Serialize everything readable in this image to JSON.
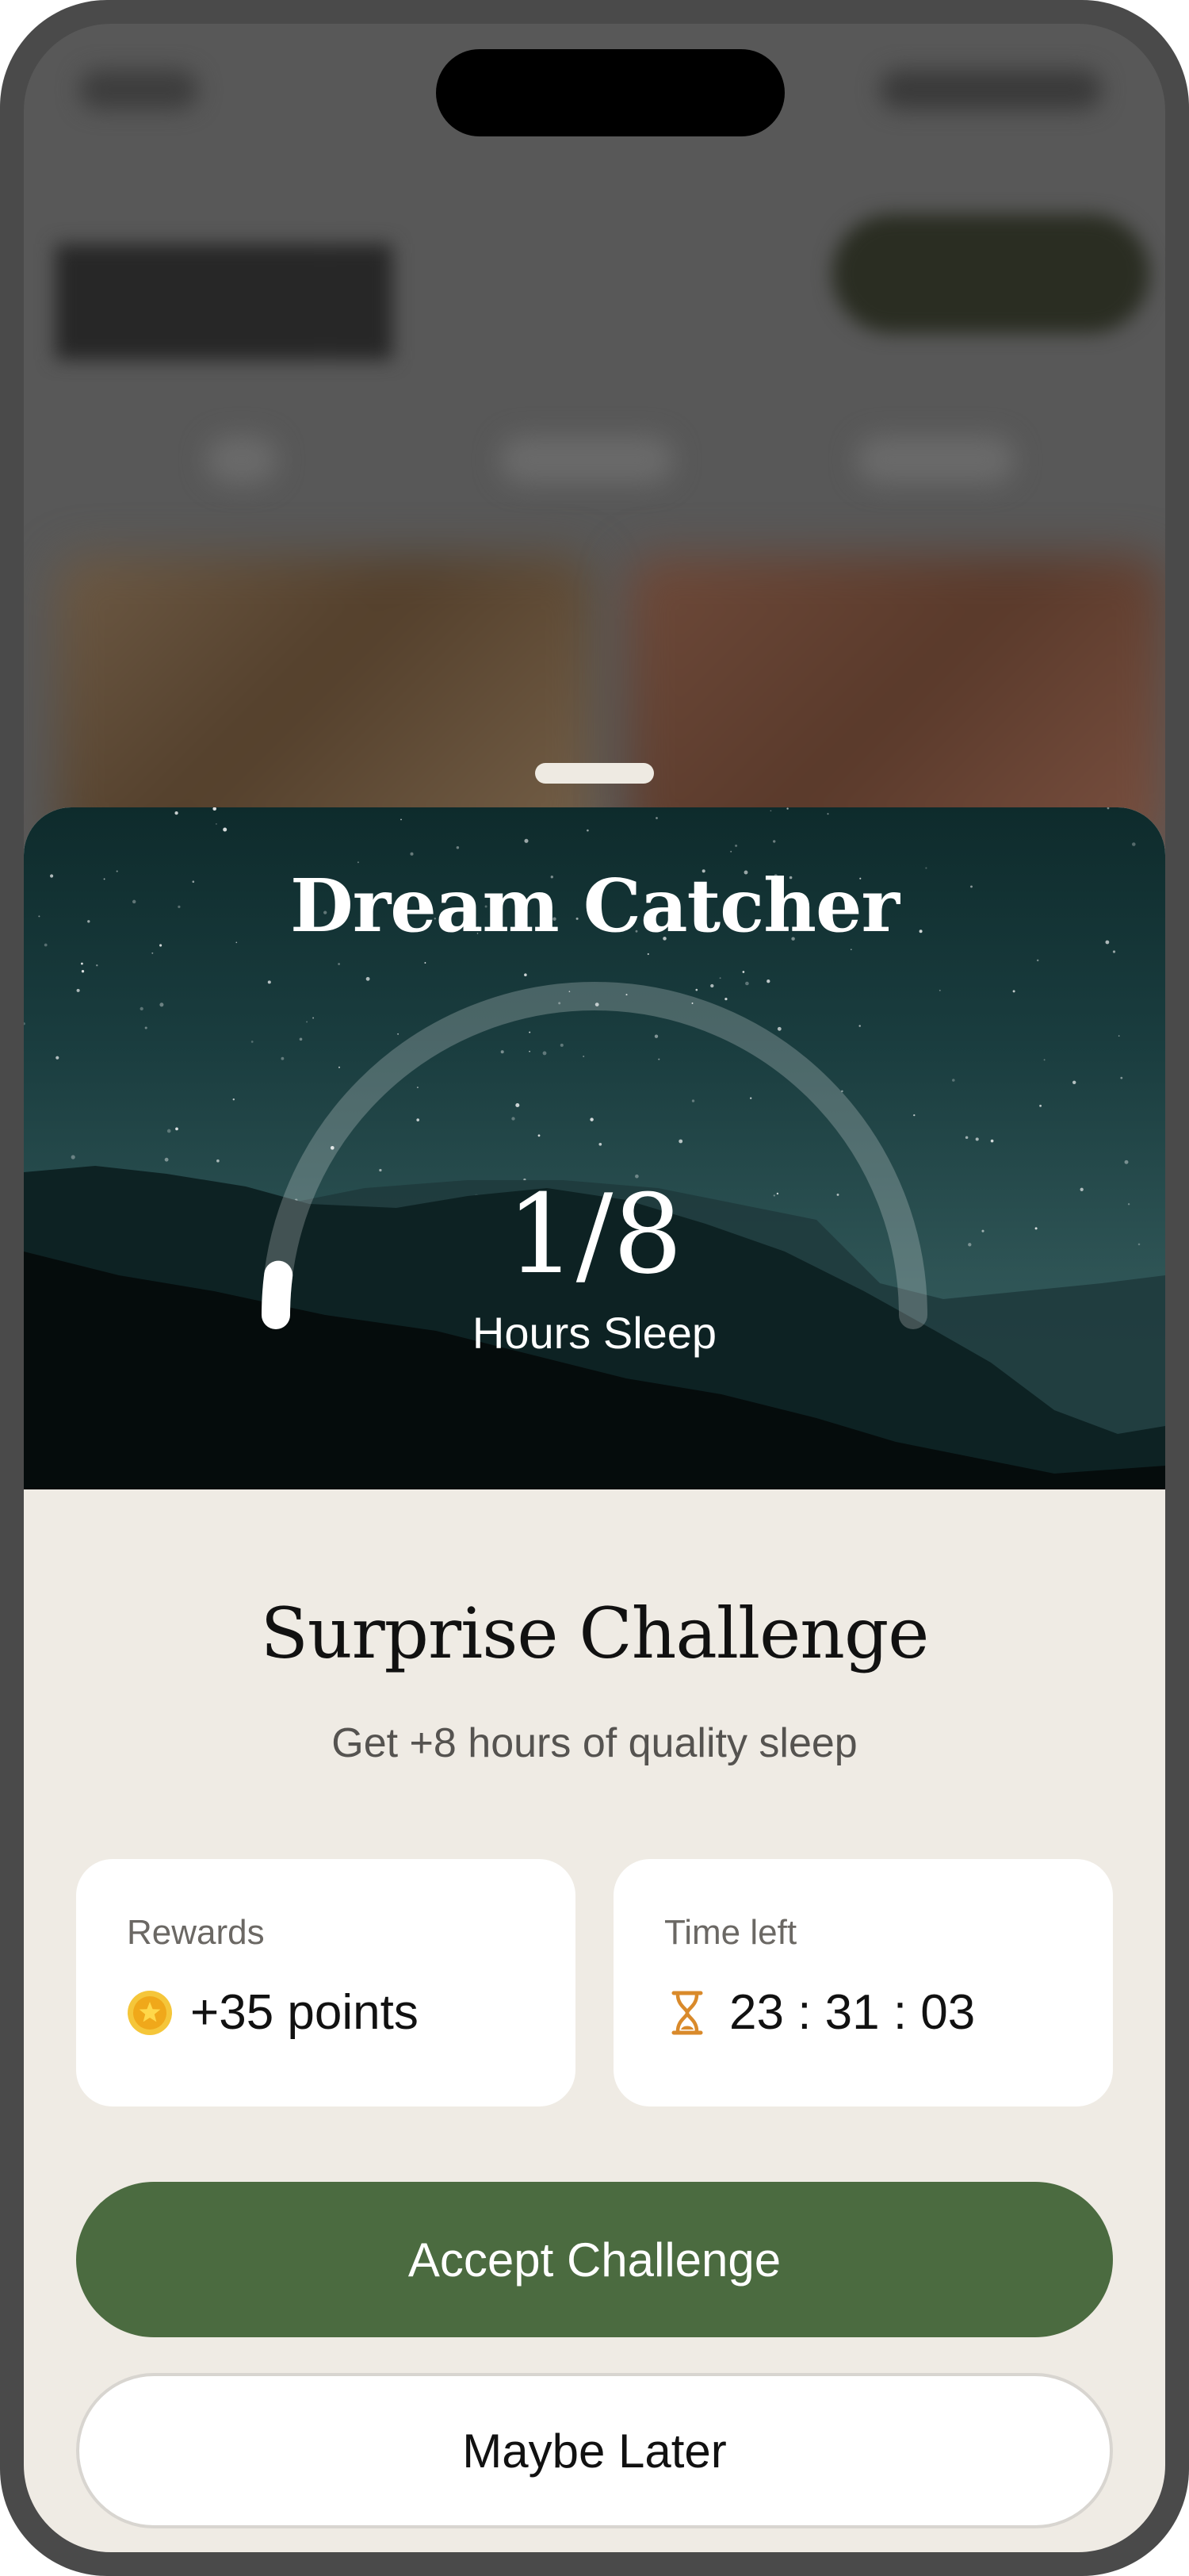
{
  "sheet": {
    "hero_title": "Dream Catcher",
    "progress": {
      "display": "1/8",
      "label": "Hours Sleep",
      "current": 1,
      "goal": 8
    }
  },
  "challenge": {
    "title": "Surprise Challenge",
    "description": "Get +8 hours of quality sleep"
  },
  "rewards_card": {
    "label": "Rewards",
    "value": "+35 points",
    "icon": "coin-star-icon"
  },
  "time_card": {
    "label": "Time left",
    "value": "23 : 31 : 03",
    "icon": "hourglass-icon"
  },
  "buttons": {
    "accept_label": "Accept Challenge",
    "later_label": "Maybe Later"
  },
  "colors": {
    "accent_green": "#4b6b40",
    "sheet_background": "#efebe4",
    "coin_yellow": "#f5b81c",
    "hourglass_orange": "#d98a2b"
  }
}
